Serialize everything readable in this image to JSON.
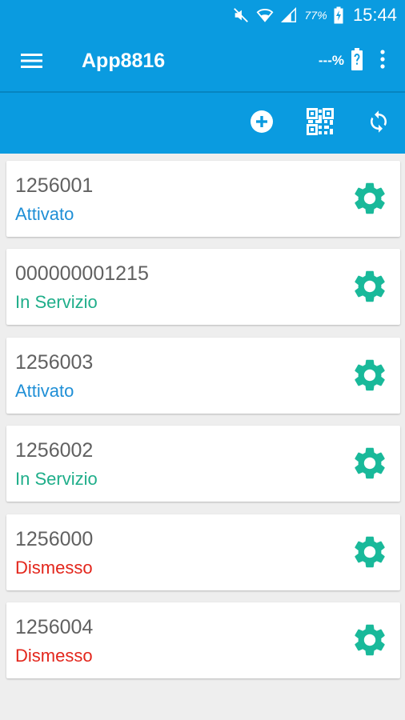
{
  "status_bar": {
    "battery_percent": "77%",
    "time": "15:44"
  },
  "app_bar": {
    "title": "App8816",
    "device_battery": "---%"
  },
  "colors": {
    "primary": "#0a9be0",
    "gear": "#19b99a",
    "Attivato": "#1f8fd6",
    "In Servizio": "#1fae8a",
    "Dismesso": "#e3261c"
  },
  "icons": {
    "menu": "hamburger-menu-icon",
    "add": "add-circle-icon",
    "qr": "qr-code-icon",
    "sync": "sync-icon",
    "settings": "gear-icon",
    "overflow": "more-vert-icon"
  },
  "devices": [
    {
      "id": "1256001",
      "status": "Attivato"
    },
    {
      "id": "000000001215",
      "status": "In Servizio"
    },
    {
      "id": "1256003",
      "status": "Attivato"
    },
    {
      "id": "1256002",
      "status": "In Servizio"
    },
    {
      "id": "1256000",
      "status": "Dismesso"
    },
    {
      "id": "1256004",
      "status": "Dismesso"
    }
  ]
}
